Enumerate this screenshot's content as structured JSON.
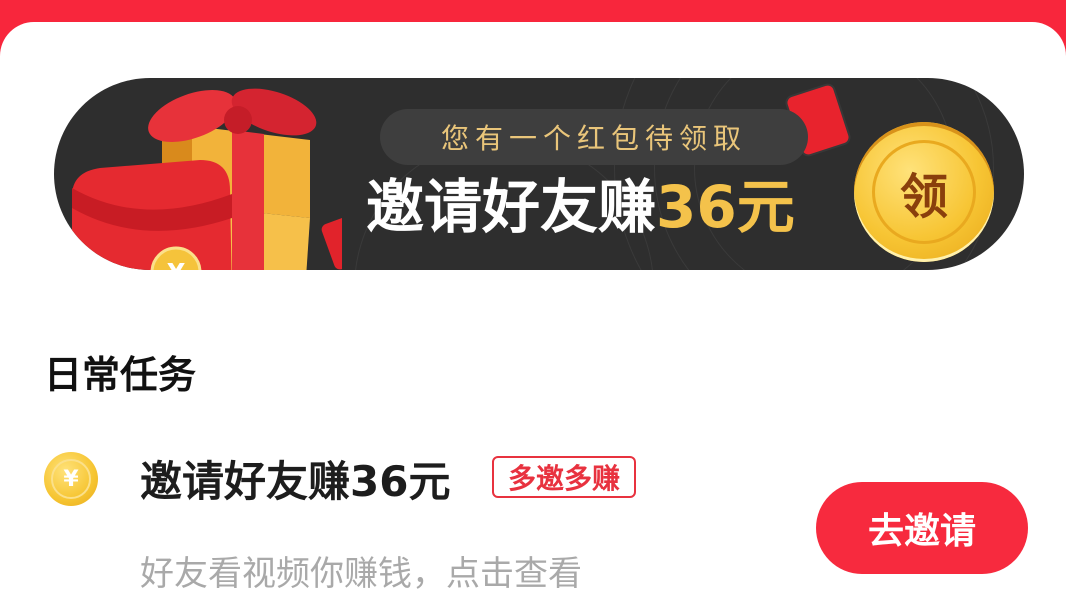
{
  "banner": {
    "subtitle": "您有一个红包待领取",
    "headline_prefix": "邀请好友赚",
    "headline_amount": "36元",
    "coin_label": "领",
    "envelope_symbol": "¥",
    "colors": {
      "background": "#2e2e2e",
      "gold": "#f4c24b",
      "red": "#e8232d"
    }
  },
  "section": {
    "title": "日常任务"
  },
  "tasks": [
    {
      "icon": "yen-coin-icon",
      "coin_symbol": "¥",
      "title": "邀请好友赚36元",
      "badge": "多邀多赚",
      "description": "好友看视频你赚钱，点击查看",
      "button_label": "去邀请"
    }
  ],
  "theme": {
    "accent": "#f72a3e",
    "header_red": "#f8263c"
  }
}
